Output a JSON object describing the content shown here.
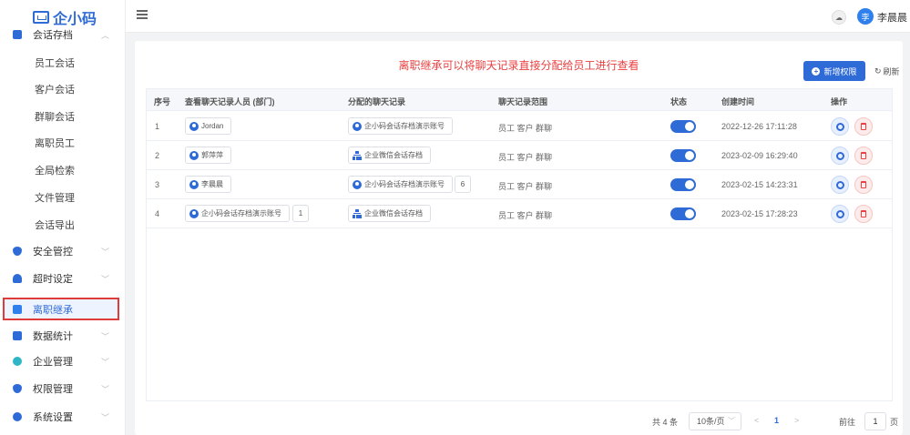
{
  "app": {
    "logo_text": "企小码",
    "user_avatar_char": "李",
    "user_name": "李晨晨"
  },
  "sidebar": {
    "groups": [
      {
        "label": "会话存档",
        "icon": "folder-icon",
        "color": "#2f6bd6",
        "expanded": true
      },
      {
        "label": "安全管控",
        "icon": "shield-icon",
        "color": "#2f6bd6"
      },
      {
        "label": "超时设定",
        "icon": "bell-icon",
        "color": "#2f6bd6"
      },
      {
        "label": "离职继承",
        "icon": "user-transfer-icon",
        "color": "#2f80ed",
        "active": true
      },
      {
        "label": "数据统计",
        "icon": "chart-icon",
        "color": "#2f6bd6"
      },
      {
        "label": "企业管理",
        "icon": "enterprise-icon",
        "color": "#2fb6c6"
      },
      {
        "label": "权限管理",
        "icon": "permission-icon",
        "color": "#2f6bd6"
      },
      {
        "label": "系统设置",
        "icon": "gear-icon",
        "color": "#2f6bd6"
      }
    ],
    "sub_items": [
      "员工会话",
      "客户会话",
      "群聊会话",
      "离职员工",
      "全局检索",
      "文件管理",
      "会话导出"
    ]
  },
  "main": {
    "notice": "离职继承可以将聊天记录直接分配给员工进行查看",
    "add_button": "新增权限",
    "refresh_label": "刷新",
    "table": {
      "headers": [
        "序号",
        "查看聊天记录人员 (部门)",
        "分配的聊天记录",
        "聊天记录范围",
        "状态",
        "创建时间",
        "操作"
      ],
      "rows": [
        {
          "index": "1",
          "viewer": "Jordan",
          "viewer_count": "",
          "assigned": "企小码会话存档演示账号",
          "assigned_type": "person",
          "assigned_count": "",
          "scope": "员工 客户 群聊",
          "enabled": true,
          "created": "2022-12-26 17:11:28"
        },
        {
          "index": "2",
          "viewer": "郭萍萍",
          "viewer_count": "",
          "assigned": "企业微信会话存档",
          "assigned_type": "org",
          "assigned_count": "",
          "scope": "员工 客户 群聊",
          "enabled": true,
          "created": "2023-02-09 16:29:40"
        },
        {
          "index": "3",
          "viewer": "李晨晨",
          "viewer_count": "",
          "assigned": "企小码会话存档演示账号",
          "assigned_type": "person",
          "assigned_count": "6",
          "scope": "员工 客户 群聊",
          "enabled": true,
          "created": "2023-02-15 14:23:31"
        },
        {
          "index": "4",
          "viewer": "企小码会话存档演示账号",
          "viewer_count": "1",
          "assigned": "企业微信会话存档",
          "assigned_type": "org",
          "assigned_count": "",
          "scope": "员工 客户 群聊",
          "enabled": true,
          "created": "2023-02-15 17:28:23"
        }
      ]
    },
    "pagination": {
      "total": "共 4 条",
      "page_size": "10条/页",
      "prev": "<",
      "current": "1",
      "next": ">",
      "goto_label": "前往",
      "goto_value": "1",
      "page_suffix": "页"
    }
  }
}
